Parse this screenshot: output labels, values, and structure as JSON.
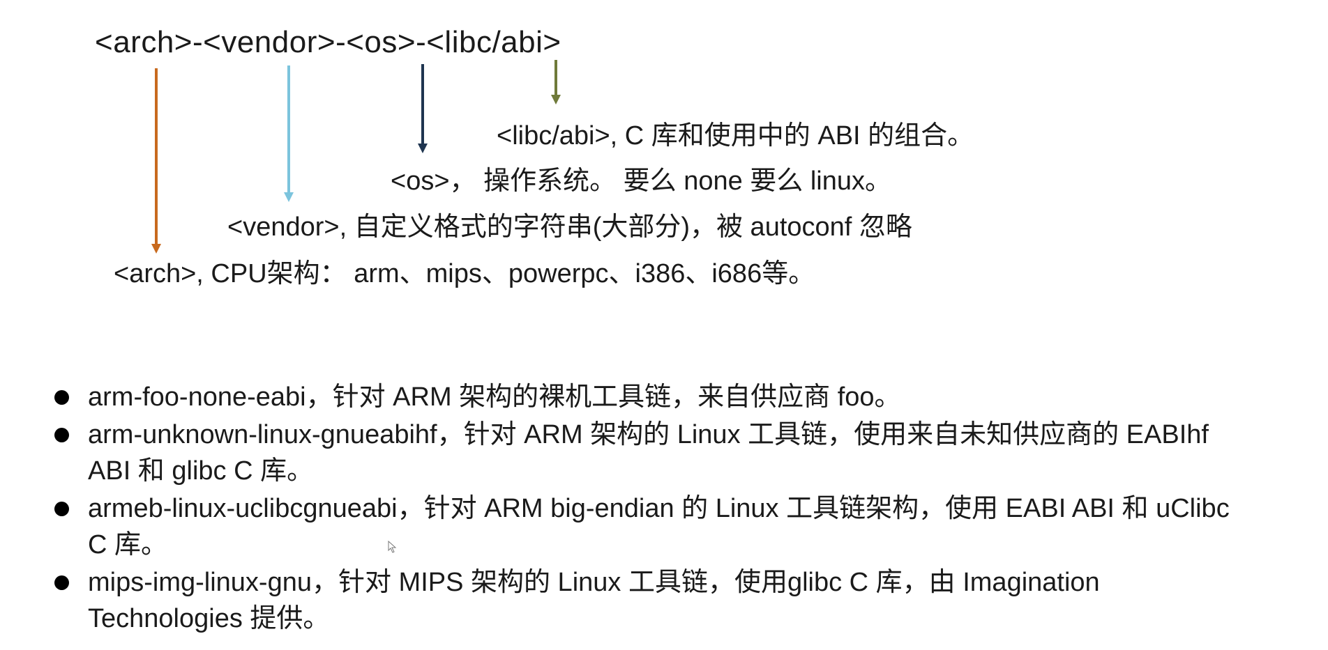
{
  "triplet": "<arch>-<vendor>-<os>-<libc/abi>",
  "colors": {
    "arch_arrow": "#c86a1e",
    "vendor_arrow": "#7cc4dd",
    "os_arrow": "#1f3550",
    "libc_arrow": "#6f7a3a",
    "text": "#1a1a1a",
    "bullet": "#000000"
  },
  "descriptions": {
    "libc": "<libc/abi>, C 库和使用中的 ABI 的组合。",
    "os": "<os>， 操作系统。 要么 none 要么 linux。",
    "vendor": "<vendor>, 自定义格式的字符串(大部分)，被 autoconf 忽略",
    "arch": "<arch>, CPU架构： arm、mips、powerpc、i386、i686等。"
  },
  "examples": [
    "arm-foo-none-eabi，针对 ARM 架构的裸机工具链，来自供应商 foo。",
    "arm-unknown-linux-gnueabihf，针对 ARM 架构的 Linux 工具链，使用来自未知供应商的 EABIhf ABI 和 glibc C 库。",
    "armeb-linux-uclibcgnueabi，针对 ARM big-endian 的 Linux 工具链架构，使用 EABI ABI 和 uClibc C 库。",
    "mips-img-linux-gnu，针对 MIPS 架构的 Linux 工具链，使用glibc C 库，由 Imagination Technologies 提供。"
  ],
  "icons": {
    "cursor": "mouse-pointer-icon",
    "bullet": "bullet-dot-icon"
  }
}
